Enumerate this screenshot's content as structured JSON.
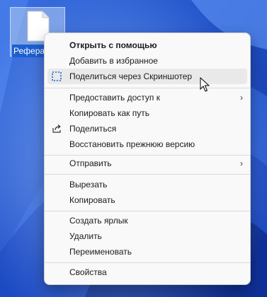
{
  "desktop": {
    "file_name": "Реферат",
    "accent_color": "#2a55c9"
  },
  "context_menu": {
    "items": [
      {
        "label": "Открыть с помощью",
        "bold": true
      },
      {
        "label": "Добавить в избранное"
      },
      {
        "label": "Поделиться через Скриншотер",
        "icon": "screenshot-select-icon",
        "hovered": true
      },
      {
        "label": "Предоставить доступ к",
        "submenu": true
      },
      {
        "label": "Копировать как путь"
      },
      {
        "label": "Поделиться",
        "icon": "share-icon"
      },
      {
        "label": "Восстановить прежнюю версию"
      },
      {
        "label": "Отправить",
        "submenu": true
      },
      {
        "label": "Вырезать"
      },
      {
        "label": "Копировать"
      },
      {
        "label": "Создать ярлык"
      },
      {
        "label": "Удалить"
      },
      {
        "label": "Переименовать"
      },
      {
        "label": "Свойства"
      }
    ],
    "submenu_glyph": "›"
  }
}
